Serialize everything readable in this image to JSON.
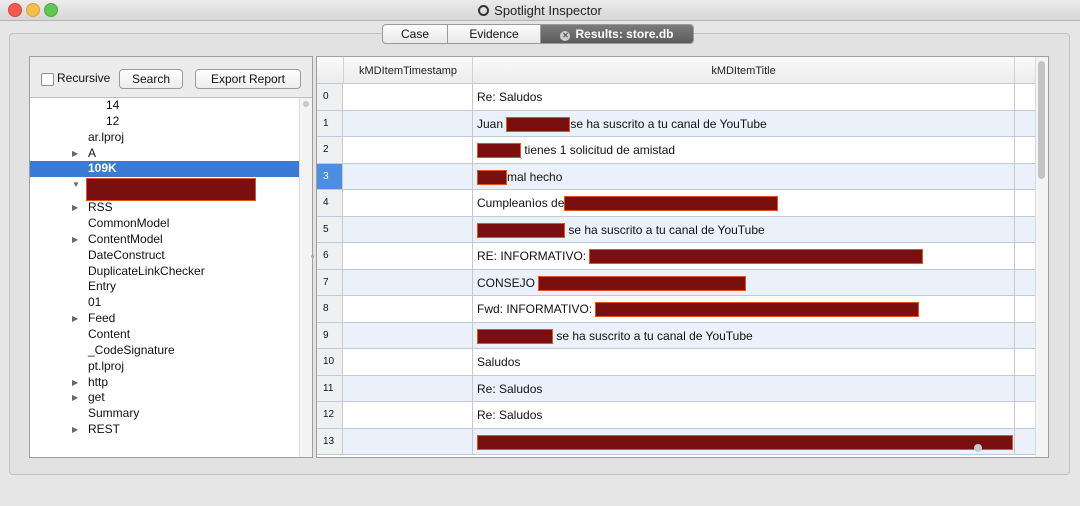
{
  "window": {
    "title": "Spotlight Inspector"
  },
  "tabs": [
    {
      "label": "Case",
      "active": false
    },
    {
      "label": "Evidence",
      "active": false
    },
    {
      "label": "Results: store.db",
      "active": true
    }
  ],
  "toolbar": {
    "recursive_label": "Recursive",
    "recursive_checked": false,
    "search_label": "Search",
    "export_label": "Export Report"
  },
  "tree": {
    "items": [
      {
        "label": "14",
        "expander": "",
        "indent": 2
      },
      {
        "label": "12",
        "expander": "",
        "indent": 2
      },
      {
        "label": "ar.lproj",
        "expander": "",
        "indent": 1
      },
      {
        "label": "A",
        "expander": "▶",
        "indent": 1
      },
      {
        "label": "109K",
        "expander": "",
        "indent": 1,
        "selected": true
      },
      {
        "label": "",
        "expander": "▼",
        "indent": 1,
        "redacted": true
      },
      {
        "label": "RSS",
        "expander": "▶",
        "indent": 1
      },
      {
        "label": "CommonModel",
        "expander": "",
        "indent": 1
      },
      {
        "label": "ContentModel",
        "expander": "▶",
        "indent": 1
      },
      {
        "label": "DateConstruct",
        "expander": "",
        "indent": 1
      },
      {
        "label": "DuplicateLinkChecker",
        "expander": "",
        "indent": 1
      },
      {
        "label": "Entry",
        "expander": "",
        "indent": 1
      },
      {
        "label": "01",
        "expander": "",
        "indent": 1
      },
      {
        "label": "Feed",
        "expander": "▶",
        "indent": 1
      },
      {
        "label": "Content",
        "expander": "",
        "indent": 1
      },
      {
        "label": "_CodeSignature",
        "expander": "",
        "indent": 1
      },
      {
        "label": "pt.lproj",
        "expander": "",
        "indent": 1
      },
      {
        "label": "http",
        "expander": "▶",
        "indent": 1
      },
      {
        "label": "get",
        "expander": "▶",
        "indent": 1
      },
      {
        "label": "Summary",
        "expander": "",
        "indent": 1
      },
      {
        "label": "REST",
        "expander": "▶",
        "indent": 1
      }
    ]
  },
  "table": {
    "columns": [
      "kMDItemTimestamp",
      "kMDItemTitle"
    ],
    "selected_row": 3,
    "rows": [
      {
        "index": "0",
        "parts": [
          {
            "text": "Re: Saludos"
          }
        ]
      },
      {
        "index": "1",
        "parts": [
          {
            "text": "Juan "
          },
          {
            "redact": 62
          },
          {
            "text": "se ha suscrito a tu canal de YouTube"
          }
        ]
      },
      {
        "index": "2",
        "parts": [
          {
            "redact": 42
          },
          {
            "text": " tienes 1 solicitud de amistad"
          }
        ]
      },
      {
        "index": "3",
        "parts": [
          {
            "redact": 28
          },
          {
            "text": "mal hecho"
          }
        ]
      },
      {
        "index": "4",
        "parts": [
          {
            "text": "Cumpleanìos de"
          },
          {
            "redact": 212
          }
        ]
      },
      {
        "index": "5",
        "parts": [
          {
            "redact": 86
          },
          {
            "text": " se ha suscrito a tu canal de YouTube"
          }
        ]
      },
      {
        "index": "6",
        "parts": [
          {
            "text": "RE: INFORMATIVO: "
          },
          {
            "redact": 332
          }
        ]
      },
      {
        "index": "7",
        "parts": [
          {
            "text": "CONSEJO "
          },
          {
            "redact": 206
          }
        ]
      },
      {
        "index": "8",
        "parts": [
          {
            "text": "Fwd: INFORMATIVO: "
          },
          {
            "redact": 322
          }
        ]
      },
      {
        "index": "9",
        "parts": [
          {
            "redact": 74
          },
          {
            "text": " se ha suscrito a tu canal de YouTube"
          }
        ]
      },
      {
        "index": "10",
        "parts": [
          {
            "text": "Saludos"
          }
        ]
      },
      {
        "index": "11",
        "parts": [
          {
            "text": "Re: Saludos"
          }
        ]
      },
      {
        "index": "12",
        "parts": [
          {
            "text": "Re: Saludos"
          }
        ]
      },
      {
        "index": "13",
        "parts": [
          {
            "redact": 534
          }
        ]
      }
    ]
  },
  "colors": {
    "selection": "#3a7bd5",
    "redaction_fill": "#7a0f0f",
    "redaction_border": "#e1541f",
    "alt_row": "#ebf1fb"
  }
}
